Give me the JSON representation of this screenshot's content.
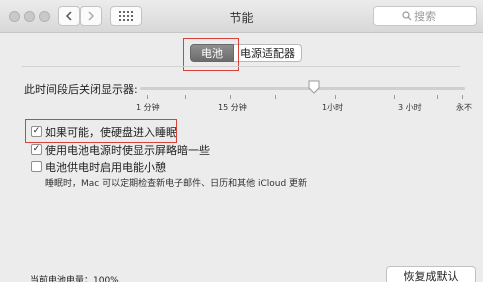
{
  "window": {
    "title": "节能",
    "search_placeholder": "搜索"
  },
  "tabs": [
    {
      "label": "电池",
      "selected": true
    },
    {
      "label": "电源适配器",
      "selected": false
    }
  ],
  "sleep_setting": {
    "label": "此时间段后关闭显示器:",
    "ticks": [
      "1 分钟",
      "15 分钟",
      "1小时",
      "3 小时",
      "永不"
    ]
  },
  "options": [
    {
      "label": "如果可能，使硬盘进入睡眠",
      "checked": true
    },
    {
      "label": "使用电池电源时使显示屏略暗一些",
      "checked": true
    },
    {
      "label": "电池供电时启用电能小憩",
      "checked": false
    }
  ],
  "power_nap_note": "睡眠时，Mac 可以定期检查新电子邮件、日历和其他 iCloud 更新",
  "battery_status": "当前电池电量：100%",
  "restore_button": "恢复成默认"
}
